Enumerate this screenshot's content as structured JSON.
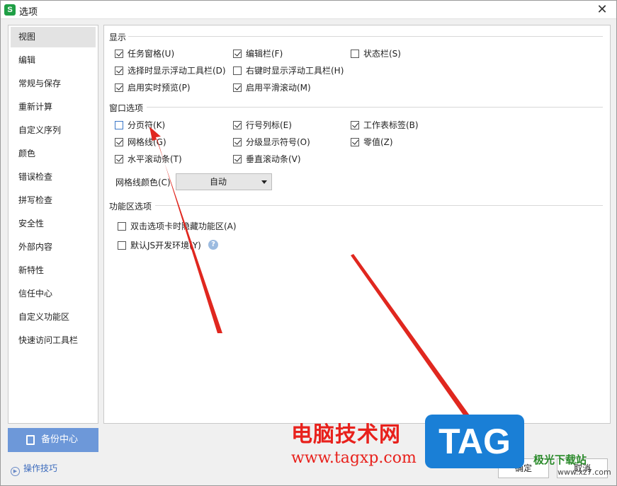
{
  "window": {
    "title": "选项",
    "app_icon_letter": "S"
  },
  "sidebar": {
    "items": [
      {
        "label": "视图",
        "active": true
      },
      {
        "label": "编辑"
      },
      {
        "label": "常规与保存"
      },
      {
        "label": "重新计算"
      },
      {
        "label": "自定义序列"
      },
      {
        "label": "颜色"
      },
      {
        "label": "错误检查"
      },
      {
        "label": "拼写检查"
      },
      {
        "label": "安全性"
      },
      {
        "label": "外部内容"
      },
      {
        "label": "新特性"
      },
      {
        "label": "信任中心"
      },
      {
        "label": "自定义功能区"
      },
      {
        "label": "快速访问工具栏"
      }
    ],
    "backup_label": "备份中心",
    "tips_label": "操作技巧"
  },
  "sections": {
    "display": {
      "title": "显示",
      "options": [
        {
          "label": "任务窗格(U)",
          "checked": true
        },
        {
          "label": "编辑栏(F)",
          "checked": true
        },
        {
          "label": "状态栏(S)",
          "checked": false
        },
        {
          "label": "选择时显示浮动工具栏(D)",
          "checked": true
        },
        {
          "label": "右键时显示浮动工具栏(H)",
          "checked": false
        },
        {
          "label": "启用实时预览(P)",
          "checked": true
        },
        {
          "label": "启用平滑滚动(M)",
          "checked": true
        }
      ]
    },
    "window_options": {
      "title": "窗口选项",
      "options": [
        {
          "label": "分页符(K)",
          "checked": false
        },
        {
          "label": "行号列标(E)",
          "checked": true
        },
        {
          "label": "工作表标签(B)",
          "checked": true
        },
        {
          "label": "网格线(G)",
          "checked": true
        },
        {
          "label": "分级显示符号(O)",
          "checked": true
        },
        {
          "label": "零值(Z)",
          "checked": true
        },
        {
          "label": "水平滚动条(T)",
          "checked": true
        },
        {
          "label": "垂直滚动条(V)",
          "checked": true
        }
      ],
      "gridline_color_label": "网格线颜色(C)",
      "gridline_color_value": "自动"
    },
    "ribbon": {
      "title": "功能区选项",
      "options": [
        {
          "label": "双击选项卡时隐藏功能区(A)",
          "checked": false
        },
        {
          "label": "默认JS开发环境(Y)",
          "checked": false
        }
      ],
      "help_glyph": "?"
    }
  },
  "footer": {
    "ok_label": "确定",
    "cancel_label": "取消"
  },
  "watermark": {
    "cn_text": "电脑技术网",
    "url_text": "www.tagxp.com",
    "tag_text": "TAG",
    "site_text": "极光下载站",
    "site_url": "www.xz7.com"
  },
  "colors": {
    "arrow": "#e0271f",
    "accent": "#6d98d9",
    "tag_bg": "#1a7fd6"
  }
}
